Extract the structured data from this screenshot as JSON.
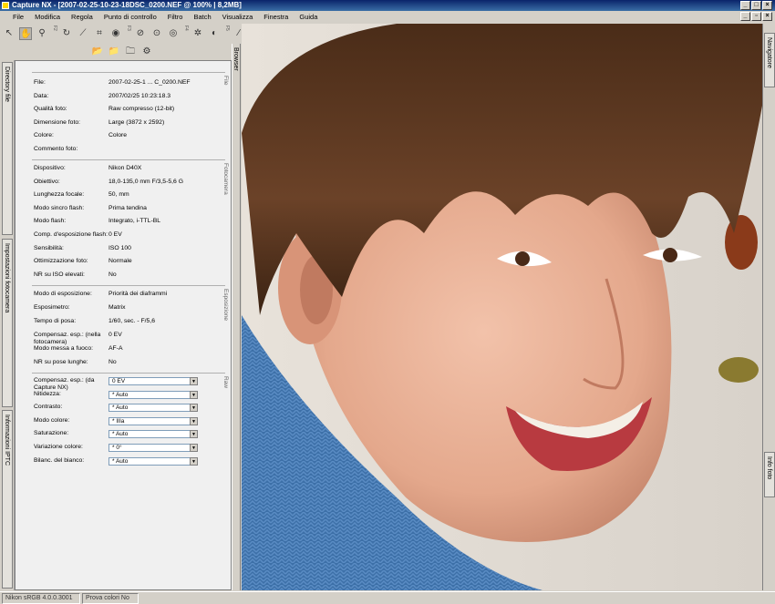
{
  "window": {
    "title": "Capture NX - [2007-02-25-10-23-18DSC_0200.NEF @ 100% | 8,2MB]"
  },
  "menu": [
    "File",
    "Modifica",
    "Regola",
    "Punto di controllo",
    "Filtro",
    "Batch",
    "Visualizza",
    "Finestra",
    "Guida"
  ],
  "toolbar": {
    "group_labels": [
      "F2",
      "F3",
      "F4",
      "F5",
      "F6"
    ]
  },
  "left_tabs": [
    "Directory file",
    "Impostazioni fotocamera",
    "Informazioni IPTC"
  ],
  "browser_tab": "Browser",
  "right_tabs": [
    "Navigatore",
    "Info foto"
  ],
  "sections": {
    "file": "File",
    "camera": "Fotocamera",
    "exposure": "Esposizione",
    "raw": "Raw"
  },
  "file_info": [
    {
      "label": "File:",
      "value": "2007-02-25-1 ... C_0200.NEF"
    },
    {
      "label": "Data:",
      "value": "2007/02/25 10:23:18.3"
    },
    {
      "label": "Qualità foto:",
      "value": "Raw compresso (12-bit)"
    },
    {
      "label": "Dimensione foto:",
      "value": "Large (3872 x 2592)"
    },
    {
      "label": "Colore:",
      "value": "Colore"
    },
    {
      "label": "Commento foto:",
      "value": ""
    }
  ],
  "camera_info": [
    {
      "label": "Dispositivo:",
      "value": "Nikon D40X"
    },
    {
      "label": "Obiettivo:",
      "value": "18,0-135,0 mm F/3,5-5,6 G"
    },
    {
      "label": "Lunghezza focale:",
      "value": "50, mm"
    },
    {
      "label": "Modo sincro flash:",
      "value": "Prima tendina"
    },
    {
      "label": "Modo flash:",
      "value": "Integrato, i-TTL-BL"
    },
    {
      "label": "Comp. d'esposizione flash:",
      "value": "0 EV"
    },
    {
      "label": "Sensibilità:",
      "value": "ISO 100"
    },
    {
      "label": "Ottimizzazione foto:",
      "value": "Normale"
    },
    {
      "label": "NR su ISO elevati:",
      "value": "No"
    }
  ],
  "exposure_info": [
    {
      "label": "Modo di esposizione:",
      "value": "Priorità dei diaframmi"
    },
    {
      "label": "Esposimetro:",
      "value": "Matrix"
    },
    {
      "label": "Tempo di posa:",
      "value": "1/60, sec. - F/5,6"
    },
    {
      "label": "Compensaz. esp.: (nella fotocamera)",
      "value": "0 EV"
    },
    {
      "label": "Modo messa a fuoco:",
      "value": "AF-A"
    },
    {
      "label": "NR su pose lunghe:",
      "value": "No"
    }
  ],
  "raw_settings": [
    {
      "label": "Compensaz. esp.: (da Capture NX)",
      "value": "0 EV"
    },
    {
      "label": "Nitidezza:",
      "value": "* Auto"
    },
    {
      "label": "Contrasto:",
      "value": "* Auto"
    },
    {
      "label": "Modo colore:",
      "value": "* IIIa"
    },
    {
      "label": "Saturazione:",
      "value": "* Auto"
    },
    {
      "label": "Variazione colore:",
      "value": "* 0°"
    },
    {
      "label": "Bilanc. del bianco:",
      "value": "* Auto"
    }
  ],
  "status": {
    "profile": "Nikon sRGB 4.0.0.3001",
    "proof": "Prova colori No"
  }
}
